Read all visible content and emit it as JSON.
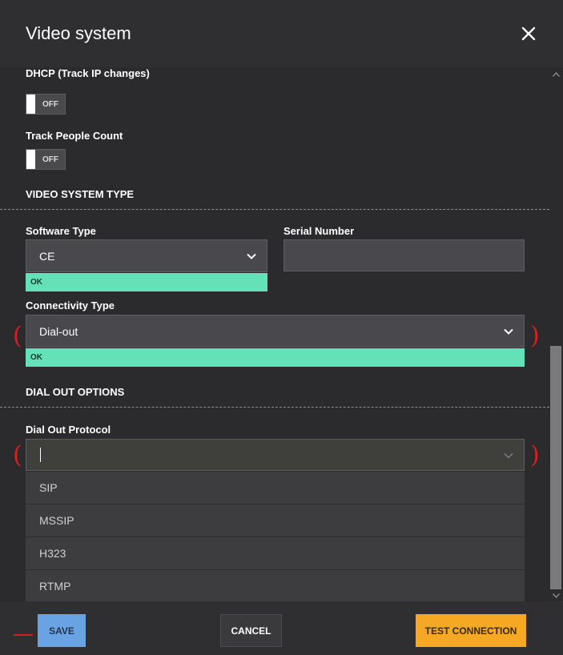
{
  "dialog": {
    "title": "Video system"
  },
  "dhcp": {
    "label": "DHCP (Track IP changes)",
    "state": "OFF"
  },
  "people_count": {
    "label": "Track People Count",
    "state": "OFF"
  },
  "video_system_type": {
    "heading": "VIDEO SYSTEM TYPE",
    "software_type": {
      "label": "Software Type",
      "value": "CE",
      "status": "OK"
    },
    "serial_number": {
      "label": "Serial Number",
      "value": ""
    },
    "connectivity_type": {
      "label": "Connectivity Type",
      "value": "Dial-out",
      "status": "OK"
    }
  },
  "dial_out_options": {
    "heading": "DIAL OUT OPTIONS",
    "protocol": {
      "label": "Dial Out Protocol",
      "value": "",
      "options": [
        "SIP",
        "MSSIP",
        "H323",
        "RTMP"
      ]
    }
  },
  "footer": {
    "save_label": "SAVE",
    "cancel_label": "CANCEL",
    "test_label": "TEST CONNECTION"
  },
  "colors": {
    "ok_badge": "#65e1b7",
    "save_button": "#6aa3e3",
    "test_button": "#f4a824",
    "annotation_red": "#d42020"
  },
  "icons": [
    "close-icon",
    "chevron-down-icon",
    "scroll-up-icon",
    "scroll-down-icon"
  ]
}
